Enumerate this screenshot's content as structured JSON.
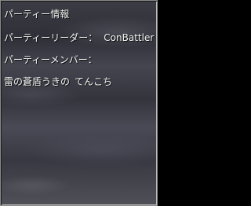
{
  "party_info": {
    "title": "パーティー情報",
    "leader_label": "パーティーリーダー：",
    "leader_name": "ConBattler",
    "members_label": "パーティーメンバー：",
    "members": [
      "雷の蒼盾うきの",
      "てんこち"
    ]
  }
}
